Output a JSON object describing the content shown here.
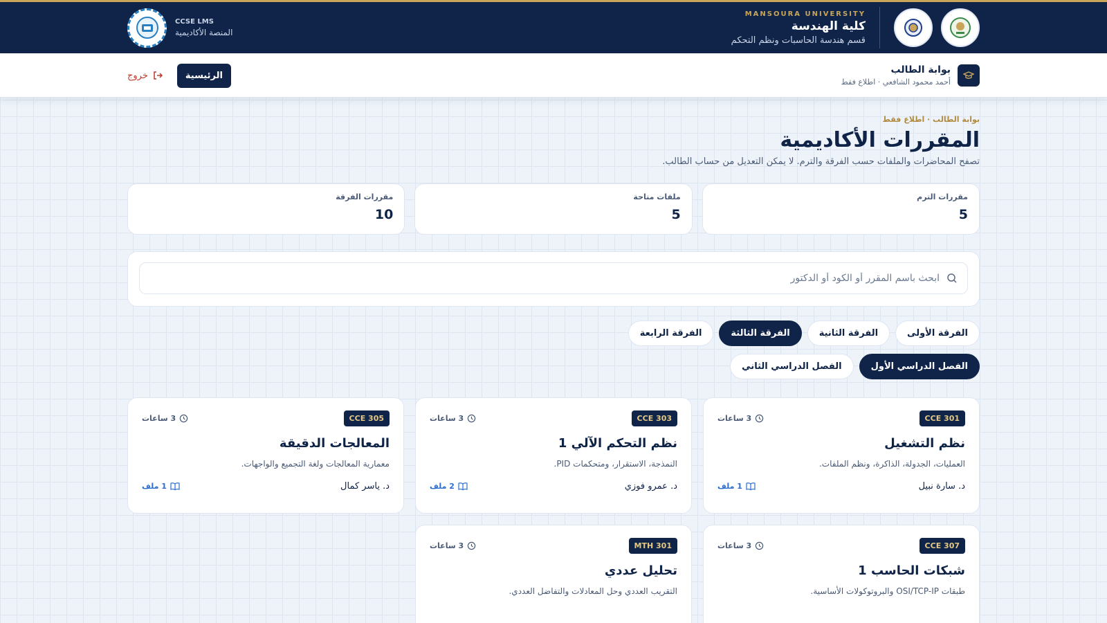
{
  "header": {
    "university": "MANSOURA UNIVERSITY",
    "faculty": "كلية الهندسة",
    "department": "قسم هندسة الحاسبات ونظم التحكم",
    "lms_kicker": "CCSE LMS",
    "lms_sub": "المنصة الأكاديمية",
    "colors": {
      "navy": "#10244a",
      "gold": "#c9a55a"
    }
  },
  "subnav": {
    "portal_title": "بوابة الطالب",
    "portal_sub": "أحمد محمود الشافعي · اطلاع فقط",
    "home_label": "الرئيسية",
    "logout_label": "خروج"
  },
  "page": {
    "crumb": "بوابة الطالب · اطلاع فقط",
    "title": "المقررات الأكاديمية",
    "subtitle": "تصفح المحاضرات والملفات حسب الفرقة والترم. لا يمكن التعديل من حساب الطالب."
  },
  "stats": [
    {
      "label": "مقررات الترم",
      "value": "5"
    },
    {
      "label": "ملفات متاحة",
      "value": "5"
    },
    {
      "label": "مقررات الفرقة",
      "value": "10"
    }
  ],
  "search": {
    "placeholder": "ابحث باسم المقرر أو الكود أو الدكتور",
    "value": ""
  },
  "years": [
    {
      "label": "الفرقة الأولى",
      "active": false
    },
    {
      "label": "الفرقة الثانية",
      "active": false
    },
    {
      "label": "الفرقة الثالثة",
      "active": true
    },
    {
      "label": "الفرقة الرابعة",
      "active": false
    }
  ],
  "semesters": [
    {
      "label": "الفصل الدراسي الأول",
      "active": true
    },
    {
      "label": "الفصل الدراسي الثاني",
      "active": false
    }
  ],
  "courses": [
    {
      "code": "CCE 301",
      "hours": "3 ساعات",
      "title": "نظم التشغيل",
      "desc": "العمليات، الجدولة، الذاكرة، ونظم الملفات.",
      "doctor": "د. سارة نبيل",
      "files": "1 ملف"
    },
    {
      "code": "CCE 303",
      "hours": "3 ساعات",
      "title": "نظم التحكم الآلي 1",
      "desc": "النمذجة، الاستقرار، ومتحكمات PID.",
      "doctor": "د. عمرو فوزي",
      "files": "2 ملف"
    },
    {
      "code": "CCE 305",
      "hours": "3 ساعات",
      "title": "المعالجات الدقيقة",
      "desc": "معمارية المعالجات ولغة التجميع والواجهات.",
      "doctor": "د. ياسر كمال",
      "files": "1 ملف"
    },
    {
      "code": "CCE 307",
      "hours": "3 ساعات",
      "title": "شبكات الحاسب 1",
      "desc": "طبقات OSI/TCP-IP والبروتوكولات الأساسية.",
      "doctor": "",
      "files": ""
    },
    {
      "code": "MTH 301",
      "hours": "3 ساعات",
      "title": "تحليل عددي",
      "desc": "التقريب العددي وحل المعادلات والتفاضل العددي.",
      "doctor": "",
      "files": ""
    }
  ]
}
